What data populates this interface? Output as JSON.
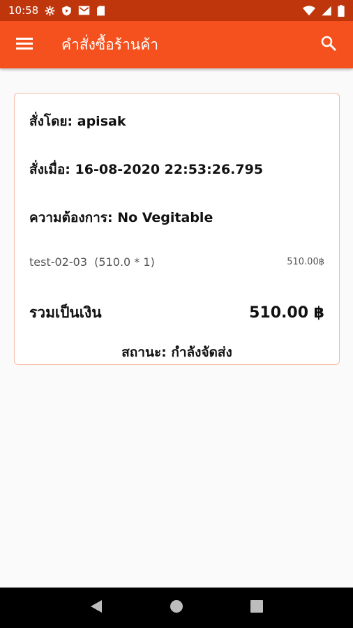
{
  "status_bar": {
    "time": "10:58",
    "left_icons": [
      "settings-icon",
      "shield-play-icon",
      "gmail-icon",
      "sd-card-icon"
    ],
    "right_icons": [
      "wifi-icon",
      "signal-icon",
      "battery-icon"
    ]
  },
  "app_bar": {
    "title": "คำสั่งซื้อร้านค้า",
    "menu_icon": "hamburger-menu-icon",
    "search_icon": "search-icon"
  },
  "order": {
    "ordered_by": "สั่งโดย: apisak",
    "ordered_at": "สั่งเมื่อ: 16-08-2020 22:53:26.795",
    "requirement": "ความต้องการ: No Vegitable",
    "items": [
      {
        "name": "test-02-03  (510.0 * 1)",
        "amount": "510.00฿"
      }
    ],
    "total_label": "รวมเป็นเงิน",
    "total_value": "510.00 ฿",
    "status": "สถานะ: กำลังจัดส่ง"
  },
  "colors": {
    "app_bar": "#f4511e",
    "status_bar": "#bf360c",
    "card_border": "#f3b9a6",
    "background": "#fafafa"
  },
  "nav_bar": {
    "icons": [
      "back-icon",
      "home-icon",
      "recents-icon"
    ]
  }
}
